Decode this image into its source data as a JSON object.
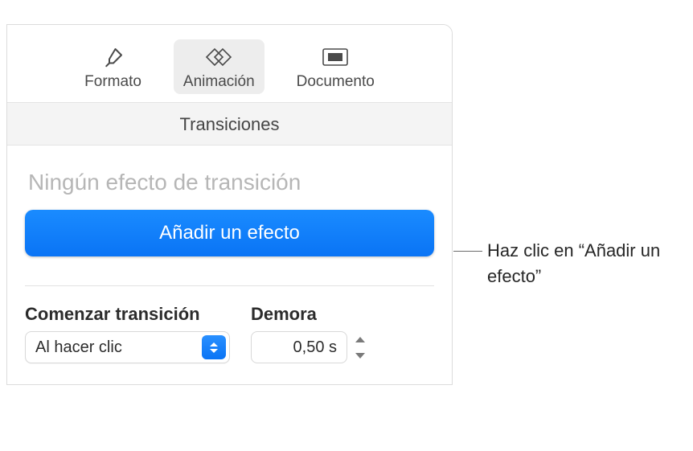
{
  "tabs": {
    "format": "Formato",
    "animation": "Animación",
    "document": "Documento"
  },
  "section_title": "Transiciones",
  "no_effect": "Ningún efecto de transición",
  "add_effect": "Añadir un efecto",
  "start_label": "Comenzar transición",
  "start_value": "Al hacer clic",
  "delay_label": "Demora",
  "delay_value": "0,50 s",
  "callout": "Haz clic en “Añadir un efecto”"
}
